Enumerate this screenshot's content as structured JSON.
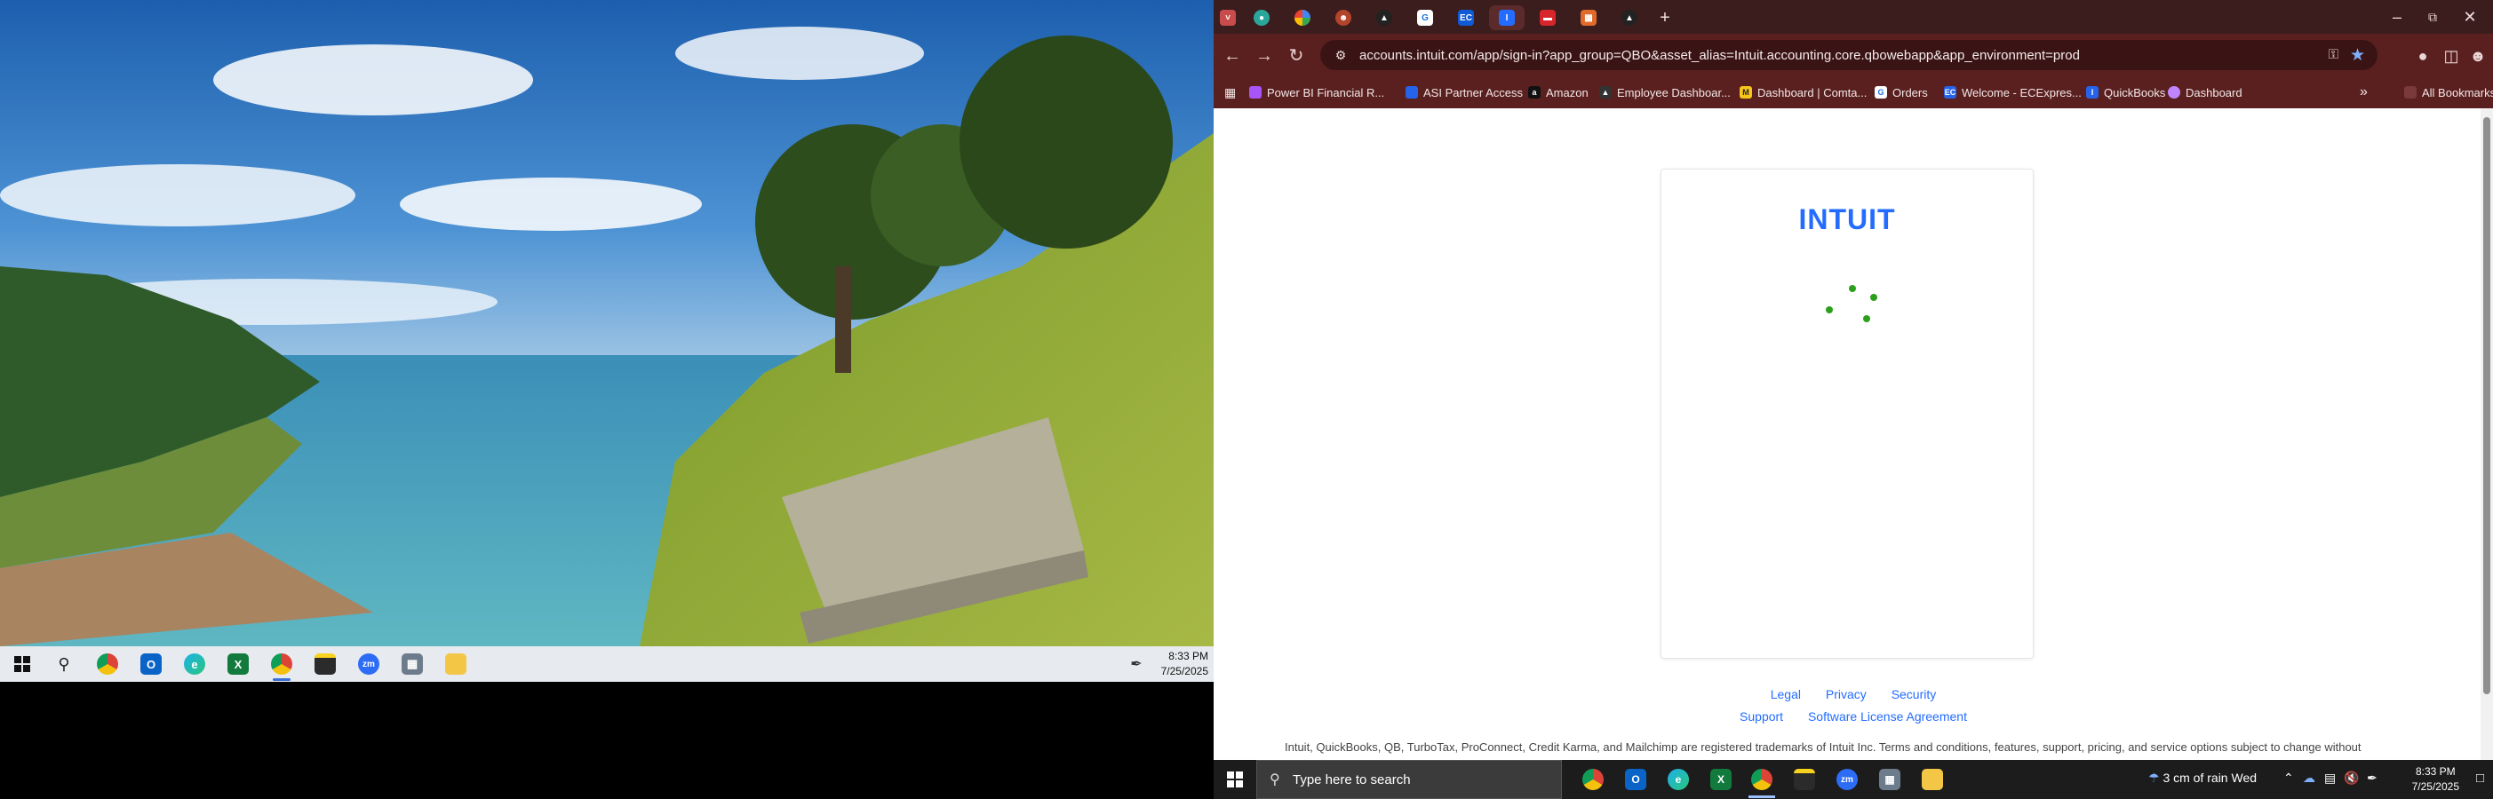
{
  "left_screen": {
    "taskbar": {
      "apps": [
        {
          "name": "start",
          "icon": "windows-icon"
        },
        {
          "name": "search",
          "icon": "search-icon"
        },
        {
          "name": "chrome",
          "icon": "chrome-icon"
        },
        {
          "name": "outlook",
          "icon": "outlook-icon"
        },
        {
          "name": "edge",
          "icon": "edge-icon"
        },
        {
          "name": "excel",
          "icon": "excel-icon"
        },
        {
          "name": "chrome-profile",
          "icon": "chrome-profile-icon"
        },
        {
          "name": "sticky-notes",
          "icon": "sticky-notes-icon"
        },
        {
          "name": "zoom",
          "icon": "zoom-icon"
        },
        {
          "name": "calculator",
          "icon": "calculator-icon"
        },
        {
          "name": "file-explorer",
          "icon": "folder-icon"
        }
      ],
      "clock": {
        "time": "8:33 PM",
        "date": "7/25/2025"
      }
    }
  },
  "browser": {
    "tabs": [
      {
        "icon": "tab-dropdown-icon"
      },
      {
        "icon": "globe-icon"
      },
      {
        "icon": "google-icon"
      },
      {
        "icon": "profile-icon"
      },
      {
        "icon": "drive-icon"
      },
      {
        "icon": "g-icon"
      },
      {
        "icon": "ec-icon",
        "label": "EC"
      },
      {
        "icon": "quickbooks-icon",
        "label": "I",
        "active": true
      },
      {
        "icon": "red-app-icon"
      },
      {
        "icon": "orange-app-icon"
      },
      {
        "icon": "drive-icon"
      }
    ],
    "new_tab_label": "+",
    "url": "accounts.intuit.com/app/sign-in?app_group=QBO&asset_alias=Intuit.accounting.core.qbowebapp&app_environment=prod",
    "bookmarks": [
      {
        "label": "Power BI Financial R...",
        "color": "#a855f7"
      },
      {
        "label": "ASI Partner Access",
        "color": "#2563eb"
      },
      {
        "label": "Amazon",
        "color": "#111111"
      },
      {
        "label": "Employee Dashboar...",
        "color": "#333333"
      },
      {
        "label": "Dashboard | Comta...",
        "color": "#f5c518"
      },
      {
        "label": "Orders",
        "color": "#ffffff"
      },
      {
        "label": "Welcome - ECExpres...",
        "color": "#2563eb"
      },
      {
        "label": "QuickBooks",
        "color": "#2563eb"
      },
      {
        "label": "Dashboard",
        "color": "#c084fc"
      }
    ],
    "all_bookmarks_label": "All Bookmarks",
    "page": {
      "logo": "INTUIT",
      "footer_row1": [
        "Legal",
        "Privacy",
        "Security"
      ],
      "footer_row2": [
        "Support",
        "Software License Agreement"
      ],
      "trademark": "Intuit, QuickBooks, QB, TurboTax, ProConnect, Credit Karma, and Mailchimp are registered trademarks of Intuit Inc. Terms and conditions, features, support, pricing, and service options subject to change without"
    },
    "accent_color": "#236cff"
  },
  "right_taskbar": {
    "search_placeholder": "Type here to search",
    "weather": "3 cm of rain Wed",
    "clock": {
      "time": "8:33 PM",
      "date": "7/25/2025"
    }
  }
}
